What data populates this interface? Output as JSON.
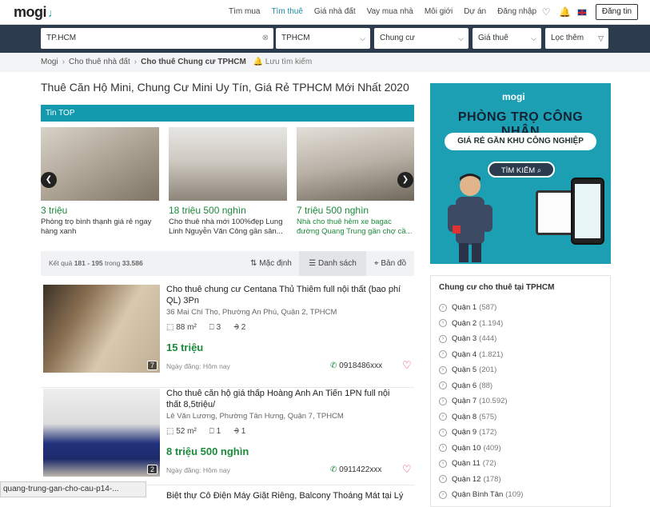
{
  "header": {
    "logo": "mogi",
    "nav": [
      "Tìm mua",
      "Tìm thuê",
      "Giá nhà đất",
      "Vay mua nhà",
      "Môi giới",
      "Dự án",
      "Đăng nhập"
    ],
    "post_button": "Đăng tin"
  },
  "search": {
    "keyword": "TP.HCM",
    "city": "TPHCM",
    "type": "Chung cư",
    "price": "Giá thuê",
    "filter": "Lọc thêm"
  },
  "breadcrumb": [
    "Mogi",
    "Cho thuê nhà đất",
    "Cho thuê Chung cư TPHCM"
  ],
  "save_search": "Lưu tìm kiếm",
  "page_title": "Thuê Căn Hộ Mini, Chung Cư Mini Uy Tín, Giá Rẻ TPHCM Mới Nhất 2020",
  "top_label": "Tin TOP",
  "top_cards": [
    {
      "price": "3 triệu",
      "desc": "Phòng trọ bình thạnh giá rẻ ngay hàng xanh"
    },
    {
      "price": "18 triệu 500 nghìn",
      "desc": "Cho thuê nhà mới 100%đẹp Lung Linh Nguyễn Văn Công gần sân..."
    },
    {
      "price": "7 triệu 500 nghìn",
      "desc": "Nhà cho thuê hẻm xe bagac đường Quang Trung gần chợ cầ..."
    }
  ],
  "results": {
    "prefix": "Kết quả",
    "range": "181 - 195",
    "mid": "trong",
    "total": "33.586"
  },
  "view_tabs": [
    "Mặc định",
    "Danh sách",
    "Bản đồ"
  ],
  "listings": [
    {
      "title": "Cho thuê chung cư Centana Thủ Thiêm full nội thất (bao phí QL) 3Pn",
      "address": "36 Mai Chí Thọ, Phường An Phú, Quận 2, TPHCM",
      "area": "88 m²",
      "beds": "3",
      "baths": "2",
      "price": "15 triệu",
      "date": "Ngày đăng: Hôm nay",
      "phone": "0918486xxx",
      "photos": "7"
    },
    {
      "title": "Cho thuê căn hộ giá thấp Hoàng Anh An Tiến 1PN full nội thất 8,5triệu/",
      "address": "Lê Văn Lương, Phường Tân Hưng, Quận 7, TPHCM",
      "area": "52 m²",
      "beds": "1",
      "baths": "1",
      "price": "8 triệu 500 nghìn",
      "date": "Ngày đăng: Hôm nay",
      "phone": "0911422xxx",
      "photos": "2"
    }
  ],
  "next_title": "Biệt thự Cô Điện Máy Giặt Riêng, Balcony Thoáng Mát tại Lý",
  "ad": {
    "logo": "mogi",
    "headline": "PHÒNG TRỌ CÔNG NHÂN",
    "sub": "GIÁ RẺ GẦN KHU CÔNG NGHIỆP",
    "cta": "TÌM KIẾM"
  },
  "sidebox": {
    "title": "Chung cư cho thuê tại TPHCM",
    "items": [
      {
        "name": "Quận 1",
        "count": "(587)"
      },
      {
        "name": "Quận 2",
        "count": "(1.194)"
      },
      {
        "name": "Quận 3",
        "count": "(444)"
      },
      {
        "name": "Quận 4",
        "count": "(1.821)"
      },
      {
        "name": "Quận 5",
        "count": "(201)"
      },
      {
        "name": "Quận 6",
        "count": "(88)"
      },
      {
        "name": "Quận 7",
        "count": "(10.592)"
      },
      {
        "name": "Quận 8",
        "count": "(575)"
      },
      {
        "name": "Quận 9",
        "count": "(172)"
      },
      {
        "name": "Quận 10",
        "count": "(409)"
      },
      {
        "name": "Quận 11",
        "count": "(72)"
      },
      {
        "name": "Quận 12",
        "count": "(178)"
      },
      {
        "name": "Quận Bình Tân",
        "count": "(109)"
      }
    ]
  },
  "status_url": "quang-trung-gan-cho-cau-p14-..."
}
